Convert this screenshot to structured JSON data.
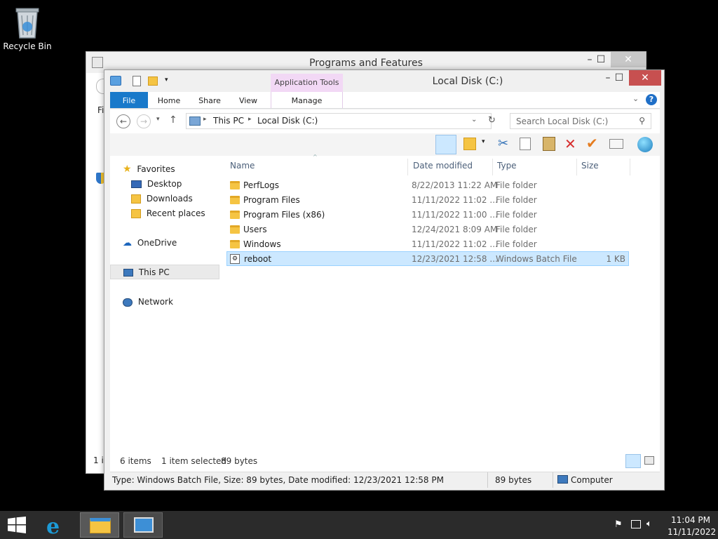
{
  "desktop": {
    "recycle_bin_label": "Recycle Bin"
  },
  "back_window": {
    "title": "Programs and Features",
    "partial_left_text": "Fi",
    "partial_status_text": "1 it"
  },
  "explorer": {
    "title": "Local Disk (C:)",
    "quick_access_icons": [
      "explorer-icon",
      "properties-icon",
      "new-folder-icon",
      "customize-arrow-icon"
    ],
    "ribbon": {
      "contextual_group": "Application Tools",
      "tabs": [
        "File",
        "Home",
        "Share",
        "View",
        "Manage"
      ]
    },
    "address": {
      "breadcrumb": [
        "This PC",
        "Local Disk (C:)"
      ],
      "search_placeholder": "Search Local Disk (C:)"
    },
    "nav": {
      "favorites": "Favorites",
      "desktop": "Desktop",
      "downloads": "Downloads",
      "recent": "Recent places",
      "onedrive": "OneDrive",
      "thispc": "This PC",
      "network": "Network"
    },
    "columns": [
      "Name",
      "Date modified",
      "Type",
      "Size"
    ],
    "files": [
      {
        "name": "PerfLogs",
        "date": "8/22/2013 11:22 AM",
        "type": "File folder",
        "size": ""
      },
      {
        "name": "Program Files",
        "date": "11/11/2022 11:02 ...",
        "type": "File folder",
        "size": ""
      },
      {
        "name": "Program Files (x86)",
        "date": "11/11/2022 11:00 ...",
        "type": "File folder",
        "size": ""
      },
      {
        "name": "Users",
        "date": "12/24/2021 8:09 AM",
        "type": "File folder",
        "size": ""
      },
      {
        "name": "Windows",
        "date": "11/11/2022 11:02 ...",
        "type": "File folder",
        "size": ""
      },
      {
        "name": "reboot",
        "date": "12/23/2021 12:58 ...",
        "type": "Windows Batch File",
        "size": "1 KB"
      }
    ],
    "status": {
      "items": "6 items",
      "selected": "1 item selected",
      "bytes": "89 bytes"
    },
    "details_bar": {
      "text": "Type: Windows Batch File, Size: 89 bytes, Date modified: 12/23/2021 12:58 PM",
      "size": "89 bytes",
      "location": "Computer"
    }
  },
  "taskbar": {
    "time": "11:04 PM",
    "date": "11/11/2022"
  },
  "colors": {
    "file_tab": "#1979ca",
    "app_tools": "#f2d8f5",
    "selection": "#cce8ff",
    "close_button": "#c75050",
    "taskbar": "#2b2b2b"
  }
}
